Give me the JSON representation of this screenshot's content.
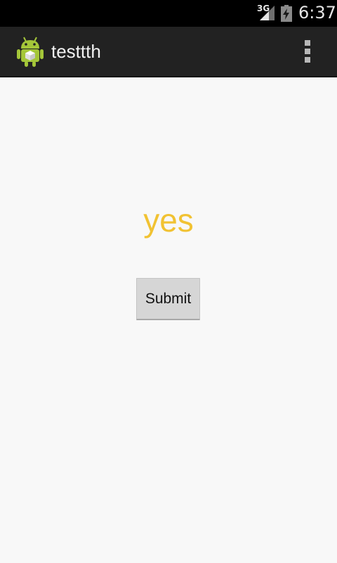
{
  "status_bar": {
    "network_type": "3G",
    "signal_icon": "signal-strength-icon",
    "battery_icon": "battery-charging-icon",
    "time": "6:37"
  },
  "action_bar": {
    "app_icon": "android-robot-icon",
    "title": "testtth",
    "overflow_icon": "overflow-menu-icon"
  },
  "content": {
    "answer_text": "yes",
    "answer_color": "#f1c232",
    "submit_label": "Submit"
  }
}
